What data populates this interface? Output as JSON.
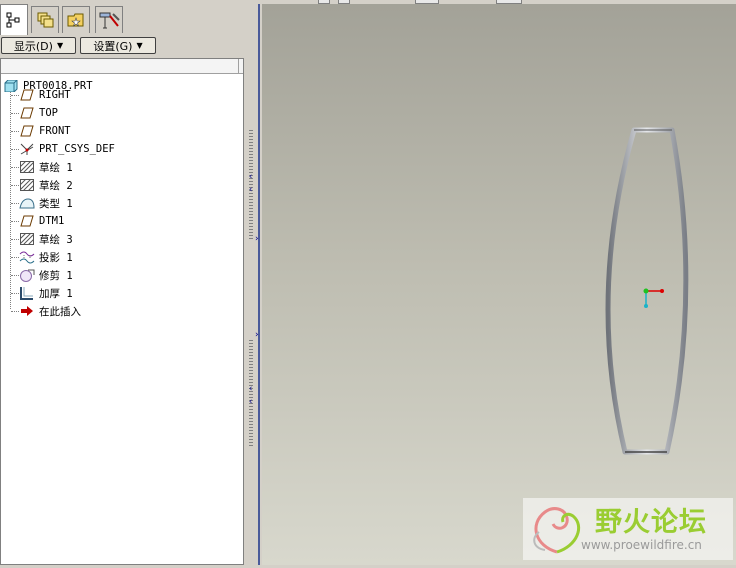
{
  "tabs": [
    {
      "icon": "model-tree-icon"
    },
    {
      "icon": "layers-icon"
    },
    {
      "icon": "folder-browser-icon"
    },
    {
      "icon": "favorites-icon"
    }
  ],
  "menus": {
    "display_label": "显示(D)",
    "settings_label": "设置(G)"
  },
  "tree": {
    "root": "PRT0018.PRT",
    "items": [
      {
        "label": "RIGHT",
        "icon": "datum-plane-icon"
      },
      {
        "label": "TOP",
        "icon": "datum-plane-icon"
      },
      {
        "label": "FRONT",
        "icon": "datum-plane-icon"
      },
      {
        "label": "PRT_CSYS_DEF",
        "icon": "coordinate-system-icon"
      },
      {
        "label": "草绘 1",
        "icon": "sketch-icon"
      },
      {
        "label": "草绘 2",
        "icon": "sketch-icon"
      },
      {
        "label": "类型 1",
        "icon": "boundary-blend-icon"
      },
      {
        "label": "DTM1",
        "icon": "datum-plane-icon"
      },
      {
        "label": "草绘 3",
        "icon": "sketch-icon"
      },
      {
        "label": "投影 1",
        "icon": "projection-icon"
      },
      {
        "label": "修剪 1",
        "icon": "trim-icon"
      },
      {
        "label": "加厚 1",
        "icon": "thicken-icon"
      },
      {
        "label": "在此插入",
        "icon": "insert-here-arrow-icon"
      }
    ]
  },
  "watermark": {
    "name": "野火论坛",
    "url": "www.proewildfire.cn"
  },
  "colors": {
    "selection_bar": "#4a5a9a",
    "graphics_top": "#a3a298",
    "graphics_bottom": "#d8d8cd",
    "insert_arrow": "#c00000",
    "watermark_green": "#9acd32"
  }
}
